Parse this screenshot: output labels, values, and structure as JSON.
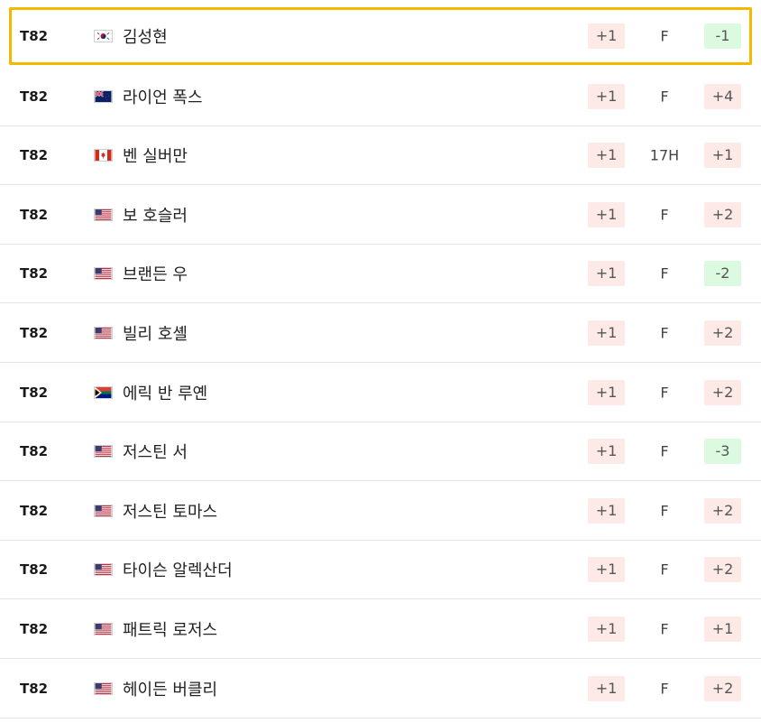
{
  "colors": {
    "highlight_border": "#f5b800",
    "over_par_bg": "#fde9e6",
    "under_par_bg": "#dcfadf",
    "row_divider": "#e6e6e6"
  },
  "rows": [
    {
      "position": "T82",
      "flag": "south-korea-flag",
      "name": "김성현",
      "today": "+1",
      "thru": "F",
      "total": "-1",
      "total_status": "under",
      "highlighted": true
    },
    {
      "position": "T82",
      "flag": "new-zealand-flag",
      "name": "라이언 폭스",
      "today": "+1",
      "thru": "F",
      "total": "+4",
      "total_status": "over",
      "highlighted": false
    },
    {
      "position": "T82",
      "flag": "canada-flag",
      "name": "벤 실버만",
      "today": "+1",
      "thru": "17H",
      "total": "+1",
      "total_status": "over",
      "highlighted": false
    },
    {
      "position": "T82",
      "flag": "usa-flag",
      "name": "보 호슬러",
      "today": "+1",
      "thru": "F",
      "total": "+2",
      "total_status": "over",
      "highlighted": false
    },
    {
      "position": "T82",
      "flag": "usa-flag",
      "name": "브랜든 우",
      "today": "+1",
      "thru": "F",
      "total": "-2",
      "total_status": "under",
      "highlighted": false
    },
    {
      "position": "T82",
      "flag": "usa-flag",
      "name": "빌리 호셸",
      "today": "+1",
      "thru": "F",
      "total": "+2",
      "total_status": "over",
      "highlighted": false
    },
    {
      "position": "T82",
      "flag": "south-africa-flag",
      "name": "에릭 반 루옌",
      "today": "+1",
      "thru": "F",
      "total": "+2",
      "total_status": "over",
      "highlighted": false
    },
    {
      "position": "T82",
      "flag": "usa-flag",
      "name": "저스틴 서",
      "today": "+1",
      "thru": "F",
      "total": "-3",
      "total_status": "under",
      "highlighted": false
    },
    {
      "position": "T82",
      "flag": "usa-flag",
      "name": "저스틴 토마스",
      "today": "+1",
      "thru": "F",
      "total": "+2",
      "total_status": "over",
      "highlighted": false
    },
    {
      "position": "T82",
      "flag": "usa-flag",
      "name": "타이슨 알렉산더",
      "today": "+1",
      "thru": "F",
      "total": "+2",
      "total_status": "over",
      "highlighted": false
    },
    {
      "position": "T82",
      "flag": "usa-flag",
      "name": "패트릭 로저스",
      "today": "+1",
      "thru": "F",
      "total": "+1",
      "total_status": "over",
      "highlighted": false
    },
    {
      "position": "T82",
      "flag": "usa-flag",
      "name": "헤이든 버클리",
      "today": "+1",
      "thru": "F",
      "total": "+2",
      "total_status": "over",
      "highlighted": false
    }
  ]
}
